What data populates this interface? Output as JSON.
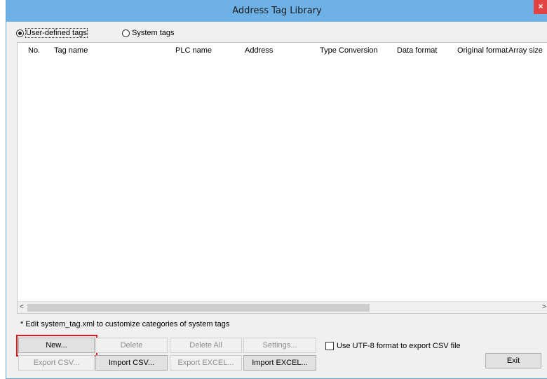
{
  "window": {
    "title": "Address Tag Library",
    "close_glyph": "×"
  },
  "tag_type": {
    "user_defined_label": "User-defined tags",
    "system_label": "System tags",
    "selected": "User-defined tags"
  },
  "table": {
    "columns": [
      "No.",
      "Tag name",
      "PLC name",
      "Address",
      "Type",
      "Conversion",
      "Data format",
      "Original format",
      "Array size"
    ],
    "rows": []
  },
  "scrollbar": {
    "left_arrow": "<",
    "right_arrow": ">"
  },
  "note": "* Edit system_tag.xml to customize categories of system tags",
  "buttons": {
    "new": "New...",
    "delete": "Delete",
    "delete_all": "Delete All",
    "settings": "Settings...",
    "export_csv": "Export CSV...",
    "import_csv": "Import CSV...",
    "export_excel": "Export EXCEL...",
    "import_excel": "Import EXCEL...",
    "exit": "Exit"
  },
  "utf8_option": {
    "label": "Use UTF-8 format to export CSV file",
    "checked": false
  },
  "colors": {
    "titlebar": "#6eb1e6",
    "close": "#e04343",
    "highlight": "#e8141b"
  }
}
